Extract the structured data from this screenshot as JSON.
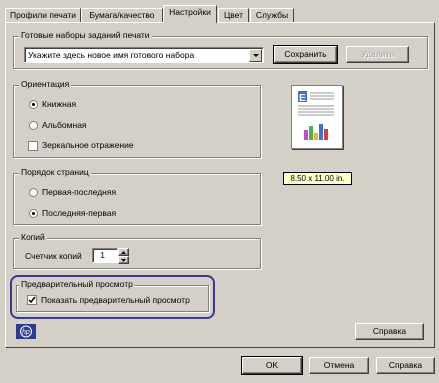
{
  "tabs": [
    {
      "label": "Профили печати"
    },
    {
      "label": "Бумага/качество"
    },
    {
      "label": "Настройки"
    },
    {
      "label": "Цвет"
    },
    {
      "label": "Службы"
    }
  ],
  "presets": {
    "title": "Готовые наборы заданий печати",
    "combo_value": "Укажите здесь новое имя готового набора",
    "save_label": "Сохранить",
    "delete_label": "Удалить"
  },
  "orientation": {
    "title": "Ориентация",
    "portrait": "Книжная",
    "landscape": "Альбомная",
    "mirror": "Зеркальное отражение",
    "selected": "portrait"
  },
  "page_order": {
    "title": "Порядок страниц",
    "first_last": "Первая-последняя",
    "last_first": "Последняя-первая",
    "selected": "last_first"
  },
  "copies": {
    "title": "Копий",
    "label": "Счетчик копий",
    "value": "1"
  },
  "preview": {
    "title": "Предварительный просмотр",
    "checkbox_label": "Показать предварительный просмотр",
    "checked": true
  },
  "paper_size": "8.50 x 11.00 in.",
  "help_panel_label": "Справка",
  "footer": {
    "ok": "OK",
    "cancel": "Отмена",
    "help": "Справка"
  },
  "colors": {
    "highlight": "#3a3a8c",
    "paper_badge": "#ffffc8",
    "hp_logo": "#2d3c8c"
  }
}
